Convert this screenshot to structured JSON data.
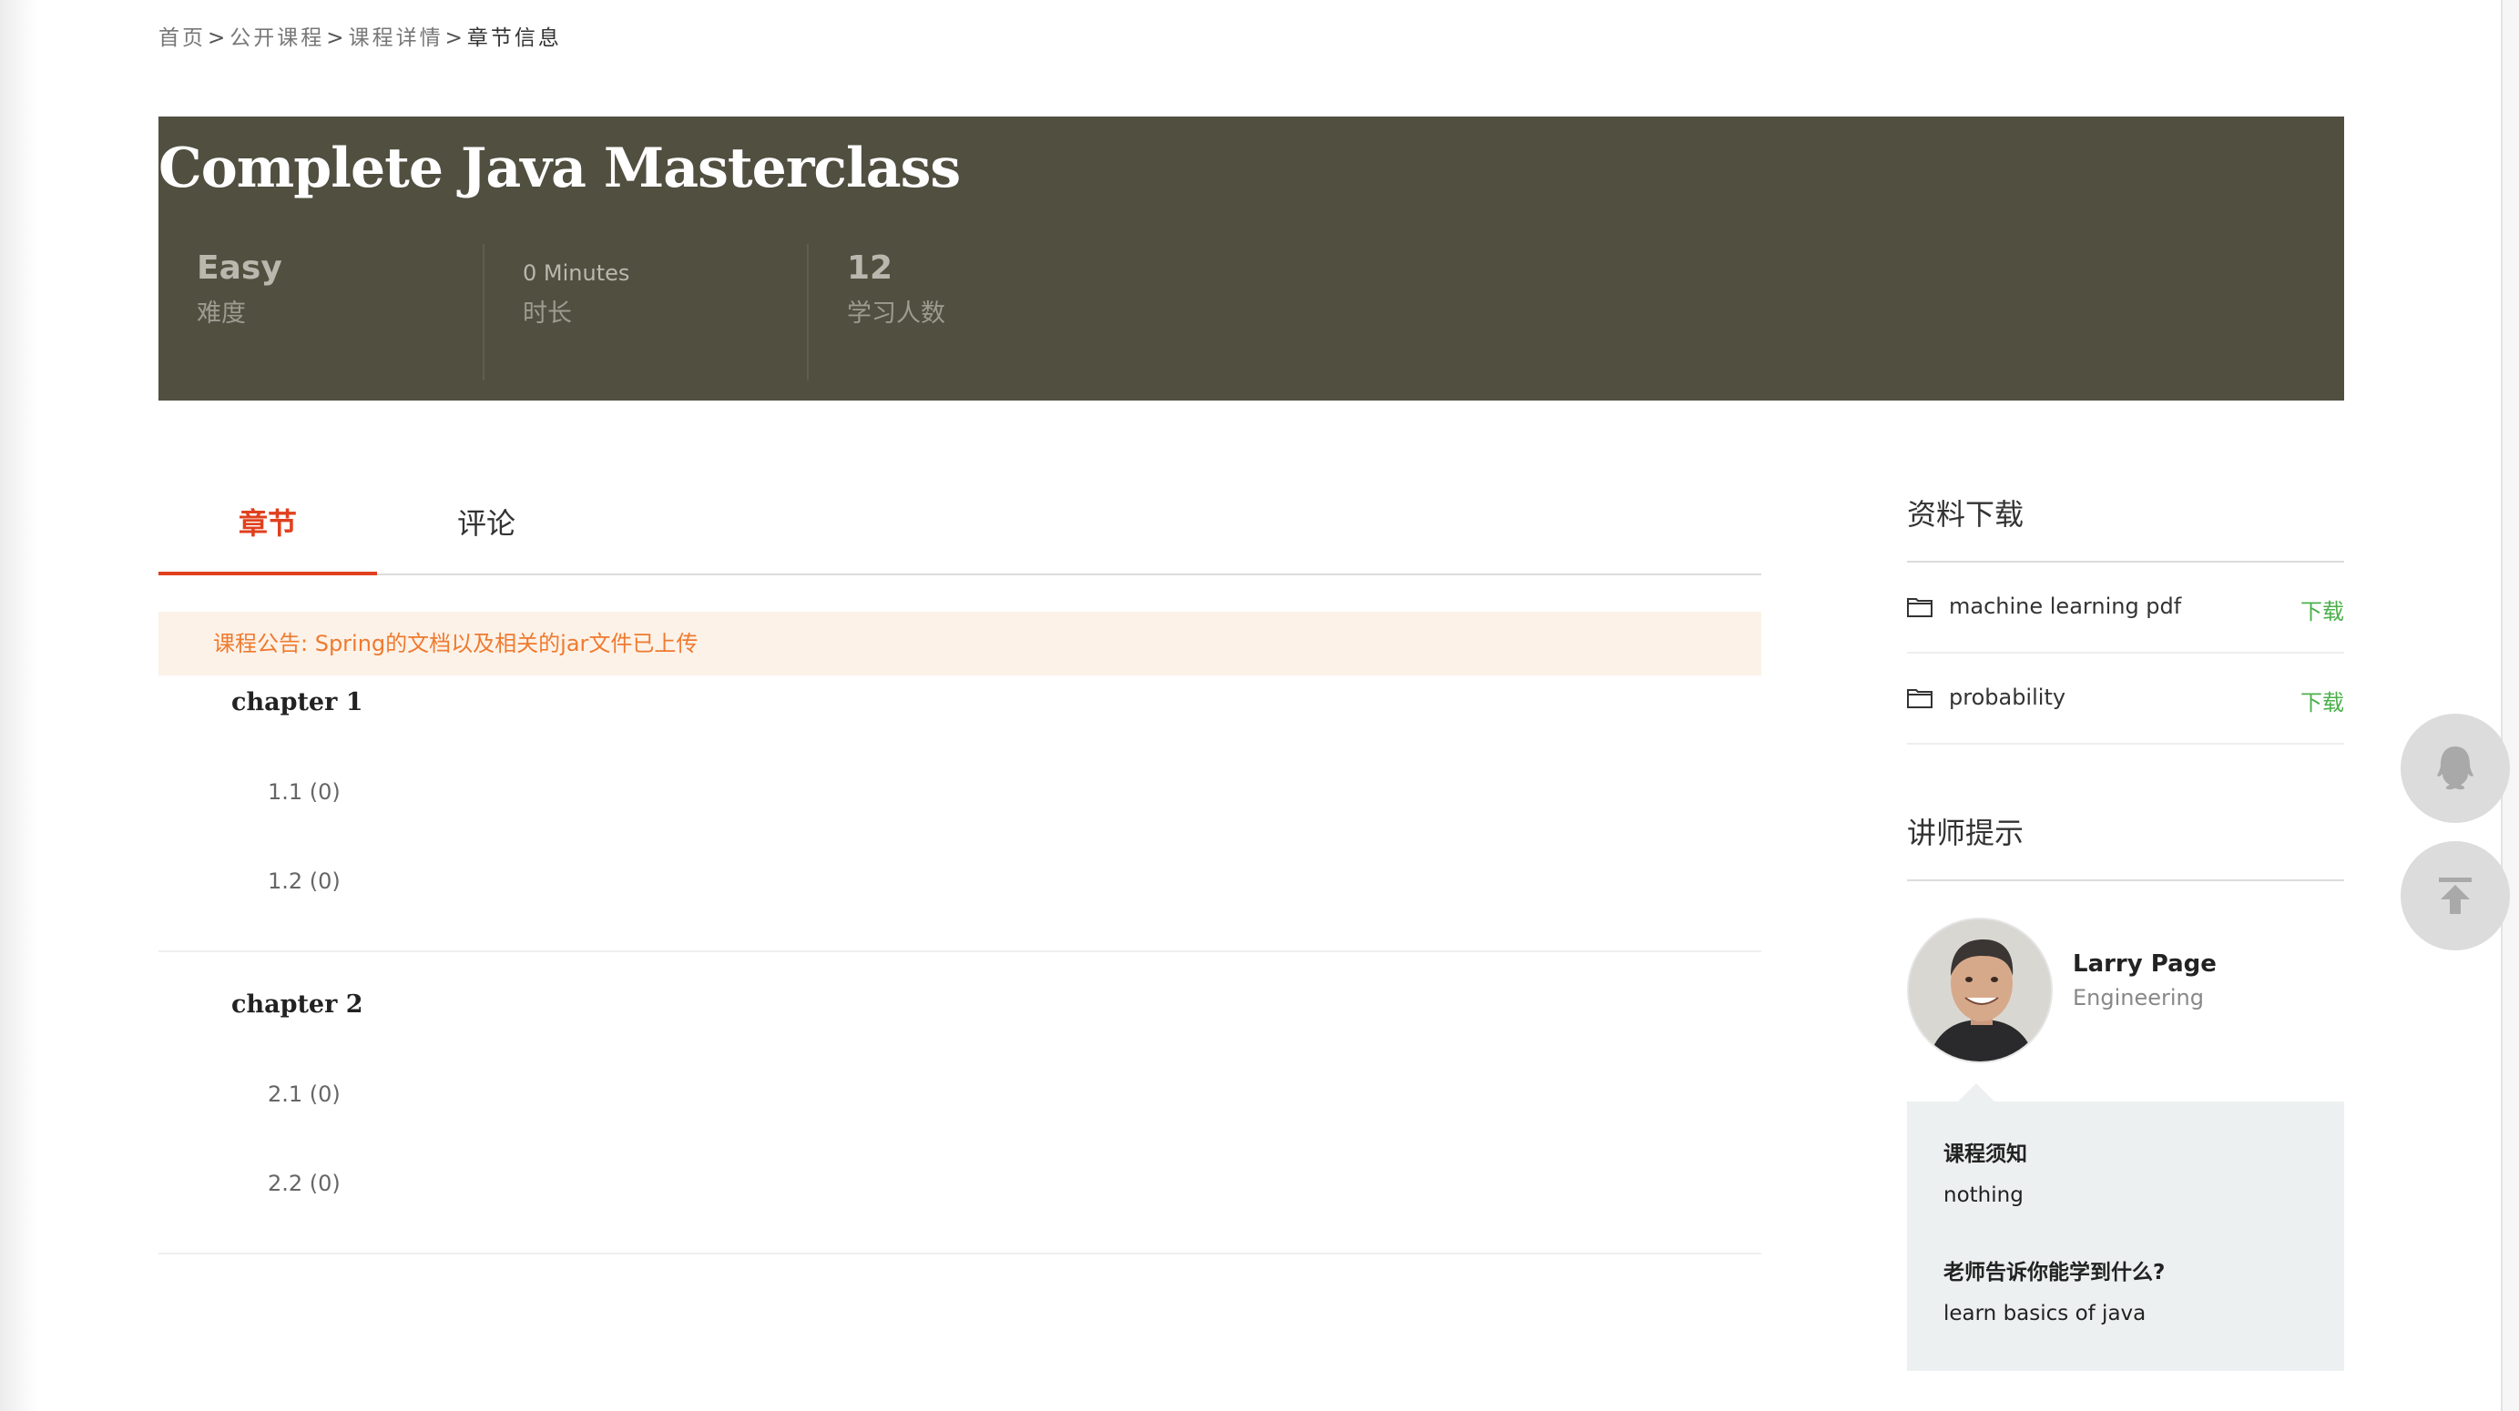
{
  "breadcrumb": {
    "home": "首页",
    "courses": "公开课程",
    "detail": "课程详情",
    "current": "章节信息",
    "separator": ">"
  },
  "course": {
    "title": "Complete Java Masterclass",
    "stats": [
      {
        "value": "Easy",
        "label": "难度"
      },
      {
        "value": "0 Minutes",
        "label": "时长"
      },
      {
        "value": "12",
        "label": "学习人数"
      }
    ]
  },
  "tabs": [
    {
      "label": "章节",
      "active": true
    },
    {
      "label": "评论",
      "active": false
    }
  ],
  "notice": "课程公告: Spring的文档以及相关的jar文件已上传",
  "chapters": [
    {
      "title": "chapter 1",
      "lessons": [
        "1.1 (0)",
        "1.2 (0)"
      ]
    },
    {
      "title": "chapter 2",
      "lessons": [
        "2.1 (0)",
        "2.2 (0)"
      ]
    }
  ],
  "downloads": {
    "title": "资料下载",
    "files": [
      {
        "name": "machine learning pdf",
        "action": "下载"
      },
      {
        "name": "probability",
        "action": "下载"
      }
    ]
  },
  "teacher": {
    "section_title": "讲师提示",
    "name": "Larry Page",
    "role": "Engineering",
    "notes_heading": "课程须知",
    "notes": "nothing",
    "learn_heading": "老师告诉你能学到什么?",
    "learn": "learn basics of java"
  },
  "colors": {
    "banner": "#514f40",
    "accent": "#e0401e",
    "notice_text": "#ef7a2f",
    "download_link": "#4bb04b"
  },
  "icons": [
    "folder-icon",
    "qq-icon",
    "back-to-top-icon"
  ]
}
